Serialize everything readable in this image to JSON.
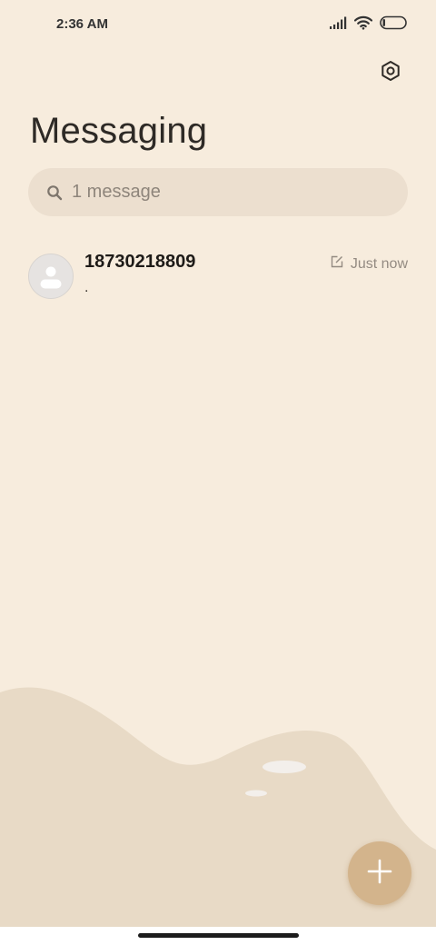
{
  "status_bar": {
    "time": "2:36 AM",
    "icons": [
      "signal-icon",
      "wifi-icon",
      "battery-icon"
    ]
  },
  "header": {
    "title": "Messaging",
    "settings_icon": "settings-icon"
  },
  "search": {
    "placeholder": "1 message",
    "icon": "search-icon"
  },
  "conversations": [
    {
      "name": "18730218809",
      "snippet": ".",
      "timestamp": "Just now",
      "status_icon": "draft-icon",
      "avatar_icon": "person-icon"
    }
  ],
  "fab": {
    "icon": "plus-icon"
  },
  "colors": {
    "background": "#f7ecdd",
    "search_bg": "#ecdfcf",
    "hill": "#e8dac6",
    "fab": "#d3b48c"
  }
}
